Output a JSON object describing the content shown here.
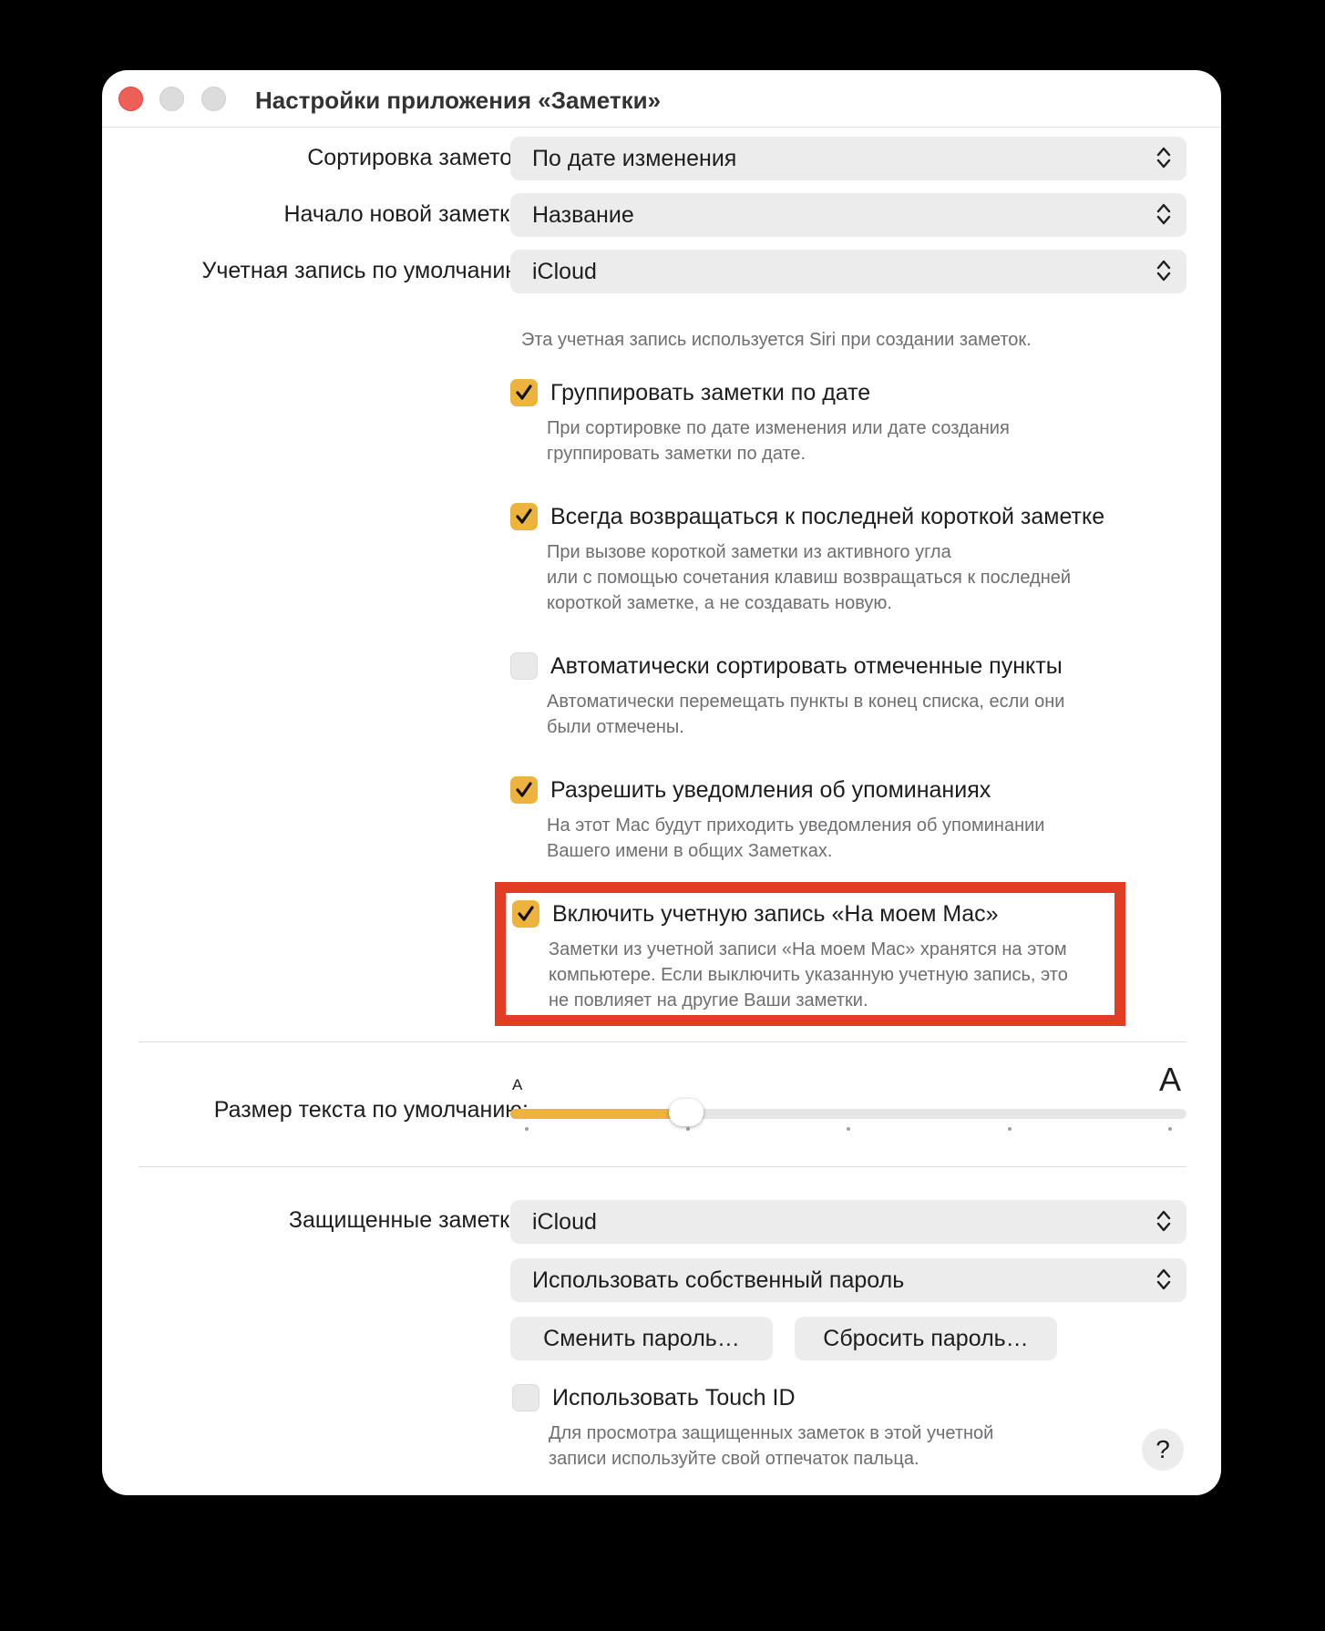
{
  "window": {
    "title": "Настройки приложения «Заметки»"
  },
  "sort": {
    "label": "Сортировка заметок:",
    "value": "По дате изменения"
  },
  "new_note_start": {
    "label": "Начало новой заметки:",
    "value": "Название"
  },
  "default_account": {
    "label": "Учетная запись по умолчанию:",
    "value": "iCloud",
    "hint": "Эта учетная запись используется Siri при создании заметок."
  },
  "options": [
    {
      "label": "Группировать заметки по дате",
      "checked": true,
      "desc": [
        "При сортировке по дате изменения или дате создания",
        "группировать заметки по дате."
      ]
    },
    {
      "label": "Всегда возвращаться к последней короткой заметке",
      "checked": true,
      "desc": [
        "При вызове короткой заметки из активного угла",
        "или с помощью сочетания клавиш возвращаться к последней",
        "короткой заметке, а не создавать новую."
      ]
    },
    {
      "label": "Автоматически сортировать отмеченные пункты",
      "checked": false,
      "desc": [
        "Автоматически перемещать пункты в конец списка, если они",
        "были отмечены."
      ]
    },
    {
      "label": "Разрешить уведомления об упоминаниях",
      "checked": true,
      "desc": [
        "На этот Mac будут приходить уведомления об упоминании",
        "Вашего имени в общих Заметках."
      ]
    },
    {
      "label": "Включить учетную запись «На моем Mac»",
      "checked": true,
      "desc": [
        "Заметки из учетной записи «На моем Mac» хранятся на этом",
        "компьютере. Если выключить указанную учетную запись, это",
        "не повлияет на другие Ваши заметки."
      ]
    }
  ],
  "text_size": {
    "label": "Размер текста по умолчанию:",
    "small_glyph": "A",
    "large_glyph": "A",
    "level_fraction": 0.26,
    "steps": 5
  },
  "locked_notes": {
    "label": "Защищенные заметки:",
    "account_value": "iCloud",
    "password_value": "Использовать собственный пароль",
    "change_password": "Сменить пароль…",
    "reset_password": "Сбросить пароль…",
    "touch_id_label": "Использовать Touch ID",
    "touch_id_checked": false,
    "touch_id_desc": [
      "Для просмотра защищенных заметок в этой учетной",
      "записи используйте свой отпечаток пальца."
    ]
  },
  "help": {
    "label": "?"
  },
  "colors": {
    "accent": "#ecb43f",
    "highlight_border": "#e33c24",
    "close_button": "#ed5f57"
  }
}
